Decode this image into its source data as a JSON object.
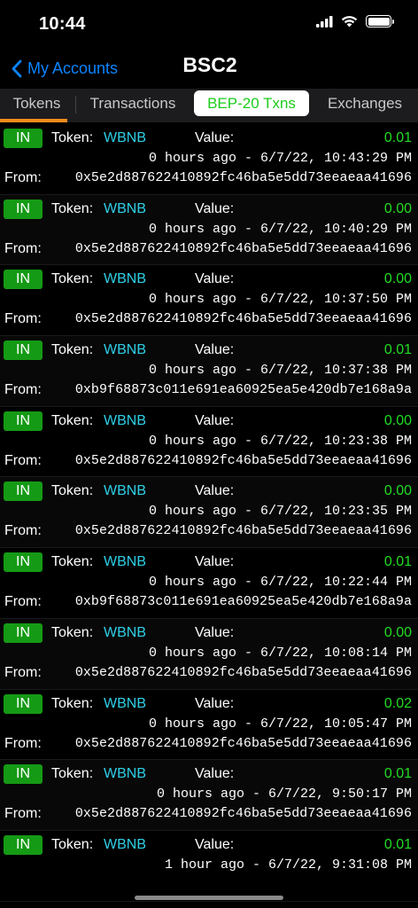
{
  "status": {
    "time": "10:44"
  },
  "nav": {
    "back_label": "My Accounts",
    "title": "BSC2"
  },
  "tabs": [
    {
      "label": "Tokens"
    },
    {
      "label": "Transactions"
    },
    {
      "label": "BEP-20 Txns"
    },
    {
      "label": "Exchanges"
    }
  ],
  "labels": {
    "direction": "IN",
    "token": "Token:",
    "value": "Value:",
    "from": "From:"
  },
  "transactions": [
    {
      "direction": "IN",
      "token": "WBNB",
      "value": "0.01",
      "time": "0 hours ago - 6/7/22, 10:43:29 PM",
      "from": "0x5e2d887622410892fc46ba5e5dd73eeaeaa41696"
    },
    {
      "direction": "IN",
      "token": "WBNB",
      "value": "0.00",
      "time": "0 hours ago - 6/7/22, 10:40:29 PM",
      "from": "0x5e2d887622410892fc46ba5e5dd73eeaeaa41696"
    },
    {
      "direction": "IN",
      "token": "WBNB",
      "value": "0.00",
      "time": "0 hours ago - 6/7/22, 10:37:50 PM",
      "from": "0x5e2d887622410892fc46ba5e5dd73eeaeaa41696"
    },
    {
      "direction": "IN",
      "token": "WBNB",
      "value": "0.01",
      "time": "0 hours ago - 6/7/22, 10:37:38 PM",
      "from": "0xb9f68873c011e691ea60925ea5e420db7e168a9a"
    },
    {
      "direction": "IN",
      "token": "WBNB",
      "value": "0.00",
      "time": "0 hours ago - 6/7/22, 10:23:38 PM",
      "from": "0x5e2d887622410892fc46ba5e5dd73eeaeaa41696"
    },
    {
      "direction": "IN",
      "token": "WBNB",
      "value": "0.00",
      "time": "0 hours ago - 6/7/22, 10:23:35 PM",
      "from": "0x5e2d887622410892fc46ba5e5dd73eeaeaa41696"
    },
    {
      "direction": "IN",
      "token": "WBNB",
      "value": "0.01",
      "time": "0 hours ago - 6/7/22, 10:22:44 PM",
      "from": "0xb9f68873c011e691ea60925ea5e420db7e168a9a"
    },
    {
      "direction": "IN",
      "token": "WBNB",
      "value": "0.00",
      "time": "0 hours ago - 6/7/22, 10:08:14 PM",
      "from": "0x5e2d887622410892fc46ba5e5dd73eeaeaa41696"
    },
    {
      "direction": "IN",
      "token": "WBNB",
      "value": "0.02",
      "time": "0 hours ago - 6/7/22, 10:05:47 PM",
      "from": "0x5e2d887622410892fc46ba5e5dd73eeaeaa41696"
    },
    {
      "direction": "IN",
      "token": "WBNB",
      "value": "0.01",
      "time": "0 hours ago - 6/7/22, 9:50:17 PM",
      "from": "0x5e2d887622410892fc46ba5e5dd73eeaeaa41696"
    },
    {
      "direction": "IN",
      "token": "WBNB",
      "value": "0.01",
      "time": "1 hour ago - 6/7/22, 9:31:08 PM",
      "from": ""
    }
  ],
  "colors": {
    "accent_blue": "#0a84ff",
    "active_tab_text": "#1bcc1b",
    "tab_underline": "#f28b1c",
    "in_badge": "#159a15",
    "token_name": "#2fd0e8",
    "value_green": "#22dd22"
  },
  "icons": {
    "back": "chevron-left-icon",
    "signal": "cellular-signal-icon",
    "wifi": "wifi-icon",
    "battery": "battery-icon"
  }
}
